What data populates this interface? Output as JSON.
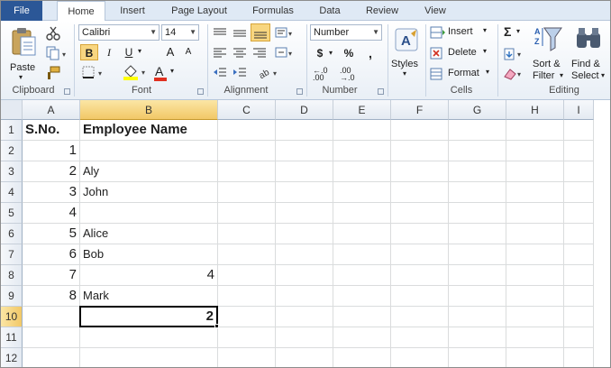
{
  "tabs": [
    "File",
    "Home",
    "Insert",
    "Page Layout",
    "Formulas",
    "Data",
    "Review",
    "View"
  ],
  "ribbon": {
    "clipboard": {
      "paste": "Paste",
      "label": "Clipboard"
    },
    "font": {
      "name": "Calibri",
      "size": "14",
      "bold": "B",
      "italic": "I",
      "underline": "U",
      "grow": "A",
      "shrink": "A",
      "color_a": "A",
      "label": "Font"
    },
    "alignment": {
      "label": "Alignment"
    },
    "number": {
      "format": "Number",
      "currency": "$",
      "percent": "%",
      "comma": ",",
      "inc_decimal": "←.0 .00",
      "dec_decimal": ".00 →.0",
      "label": "Number"
    },
    "styles": {
      "label": "Styles"
    },
    "cells": {
      "insert": "Insert",
      "delete": "Delete",
      "format": "Format",
      "label": "Cells"
    },
    "editing": {
      "sigma": "Σ",
      "sort_line1": "Sort &",
      "sort_line2": "Filter",
      "find_line1": "Find &",
      "find_line2": "Select",
      "label": "Editing"
    }
  },
  "sheet": {
    "columns": [
      "A",
      "B",
      "C",
      "D",
      "E",
      "F",
      "G",
      "H",
      "I"
    ],
    "rows": [
      "1",
      "2",
      "3",
      "4",
      "5",
      "6",
      "7",
      "8",
      "9",
      "10",
      "11",
      "12"
    ],
    "cells": {
      "A1": "S.No.",
      "B1": "Employee Name",
      "A2": "1",
      "A3": "2",
      "B3": "Aly",
      "A4": "3",
      "B4": "John",
      "A5": "4",
      "A6": "5",
      "B6": "Alice",
      "A7": "6",
      "B7": "Bob",
      "A8": "7",
      "B8": "4",
      "A9": "8",
      "B9": "Mark",
      "B10": "2"
    },
    "active_cell": "B10"
  },
  "colors": {
    "file_tab": "#2b5797",
    "selection_header": "#f2c867",
    "grid_line": "#dadcdd"
  }
}
